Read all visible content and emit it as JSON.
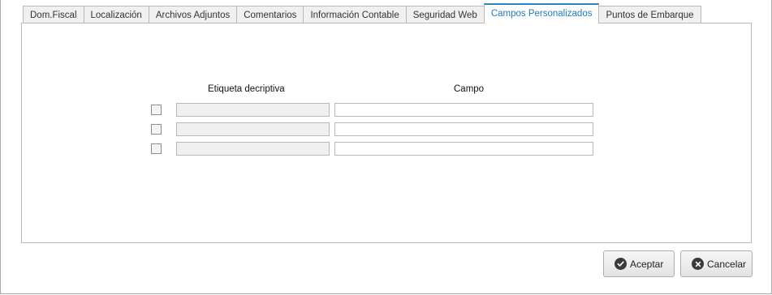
{
  "tabs": [
    {
      "label": "Dom.Fiscal",
      "active": false
    },
    {
      "label": "Localización",
      "active": false
    },
    {
      "label": "Archivos Adjuntos",
      "active": false
    },
    {
      "label": "Comentarios",
      "active": false
    },
    {
      "label": "Información Contable",
      "active": false
    },
    {
      "label": "Seguridad Web",
      "active": false
    },
    {
      "label": "Campos Personalizados",
      "active": true
    },
    {
      "label": "Puntos de Embarque",
      "active": false
    }
  ],
  "custom_fields": {
    "header_label": "Etiqueta decriptiva",
    "header_field": "Campo",
    "rows": [
      {
        "checked": false,
        "label": "",
        "value": ""
      },
      {
        "checked": false,
        "label": "",
        "value": ""
      },
      {
        "checked": false,
        "label": "",
        "value": ""
      }
    ]
  },
  "buttons": {
    "accept_label": "Aceptar",
    "accept_icon": "check-circle-icon",
    "cancel_label": "Cancelar",
    "cancel_icon": "x-circle-icon"
  },
  "colors": {
    "active_tab_text": "#1e7bbf",
    "active_tab_border": "#2b86c5"
  }
}
